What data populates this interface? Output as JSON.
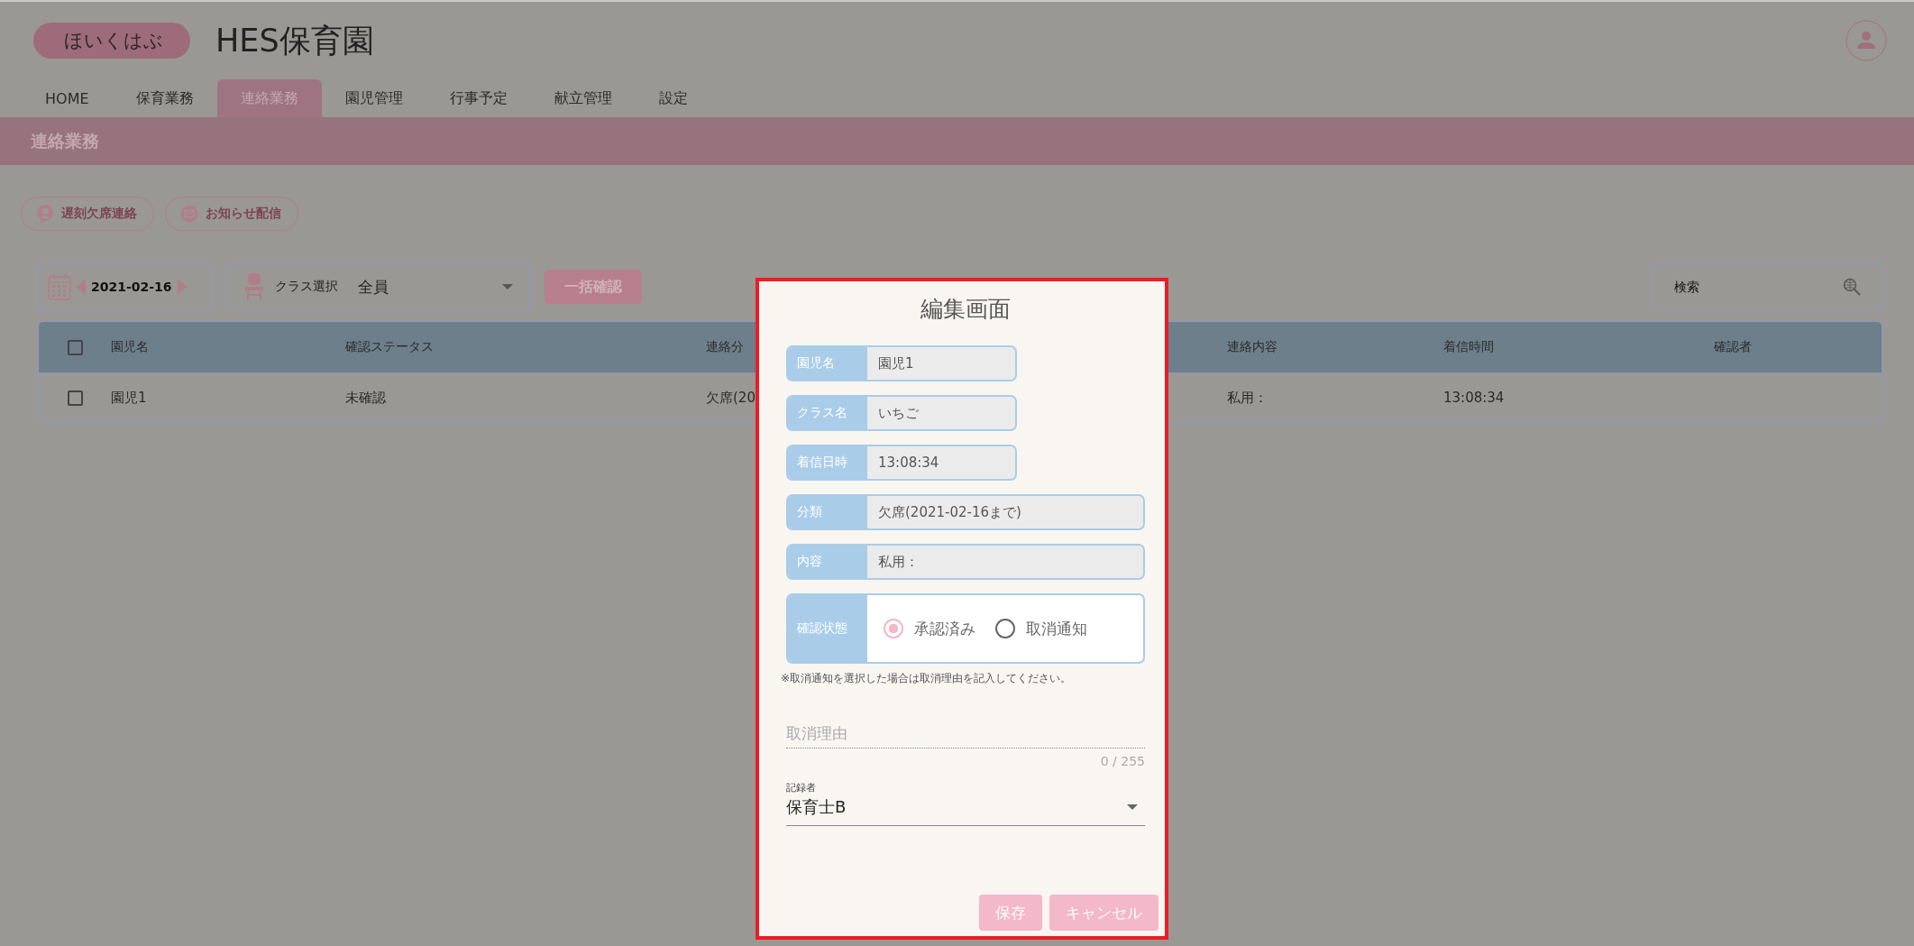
{
  "header": {
    "logo": "ほいくはぶ",
    "title": "HES保育園"
  },
  "tabs": [
    {
      "label": "HOME",
      "selected": false
    },
    {
      "label": "保育業務",
      "selected": false
    },
    {
      "label": "連絡業務",
      "selected": true
    },
    {
      "label": "園児管理",
      "selected": false
    },
    {
      "label": "行事予定",
      "selected": false
    },
    {
      "label": "献立管理",
      "selected": false
    },
    {
      "label": "設定",
      "selected": false
    }
  ],
  "page_title": "連絡業務",
  "actions": [
    {
      "label": "遅刻欠席連絡",
      "kind": "absence"
    },
    {
      "label": "お知らせ配信",
      "kind": "mail"
    }
  ],
  "toolbar": {
    "date": "2021-02-16",
    "class_label": "クラス選択",
    "class_value": "全員",
    "bulk_button": "一括確認",
    "search_placeholder": "検索"
  },
  "table": {
    "header_checked": false,
    "columns": [
      "園児名",
      "確認ステータス",
      "連絡分",
      "連絡内容",
      "着信時間",
      "確認者"
    ],
    "rows": [
      {
        "checked": false,
        "cells": [
          "園児1",
          "未確認",
          "欠席(20",
          "私用：",
          "13:08:34"
        ]
      }
    ]
  },
  "dialog": {
    "title": "編集画面",
    "info_fields": [
      {
        "label": "園児名",
        "value": "園児1"
      },
      {
        "label": "クラス名",
        "value": "いちご"
      },
      {
        "label": "着信日時",
        "value": "13:08:34"
      }
    ],
    "detail_fields": [
      {
        "label": "分類",
        "value": "欠席(2021-02-16まで)"
      },
      {
        "label": "内容",
        "value": "私用："
      }
    ],
    "status": {
      "label": "確認状態",
      "options": [
        {
          "label": "承認済み",
          "selected": true
        },
        {
          "label": "取消通知",
          "selected": false
        }
      ]
    },
    "note": "※取消通知を選択した場合は取消理由を記入してください。",
    "reason": {
      "placeholder": "取消理由",
      "counter": "0 / 255"
    },
    "recorder": {
      "label": "記録者",
      "value": "保育士B"
    },
    "buttons": [
      "保存",
      "キャンセル"
    ]
  }
}
